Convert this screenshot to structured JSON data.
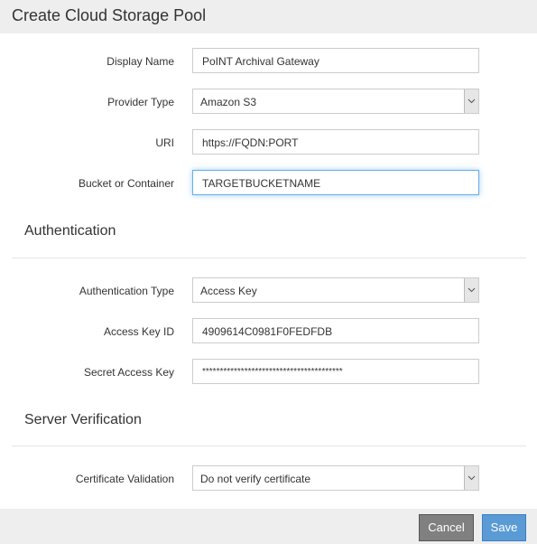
{
  "dialog": {
    "title": "Create Cloud Storage Pool"
  },
  "general": {
    "display_name": {
      "label": "Display Name",
      "value": "PoINT Archival Gateway"
    },
    "provider_type": {
      "label": "Provider Type",
      "value": "Amazon S3"
    },
    "uri": {
      "label": "URI",
      "value": "https://FQDN:PORT"
    },
    "bucket": {
      "label": "Bucket or Container",
      "value": "TARGETBUCKETNAME"
    }
  },
  "authentication": {
    "title": "Authentication",
    "auth_type": {
      "label": "Authentication Type",
      "value": "Access Key"
    },
    "access_key_id": {
      "label": "Access Key ID",
      "value": "4909614C0981F0FEDFDB"
    },
    "secret_access_key": {
      "label": "Secret Access Key",
      "value": "****************************************"
    }
  },
  "server_verification": {
    "title": "Server Verification",
    "cert_validation": {
      "label": "Certificate Validation",
      "value": "Do not verify certificate"
    }
  },
  "footer": {
    "cancel_label": "Cancel",
    "save_label": "Save"
  },
  "icons": {
    "select_arrow": "chevron-down-icon"
  }
}
